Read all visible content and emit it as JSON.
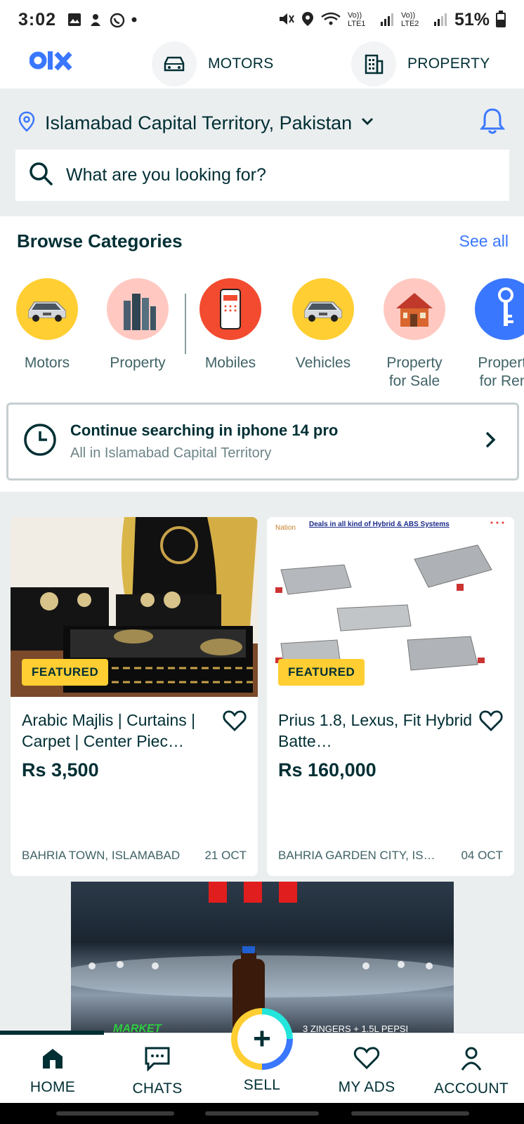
{
  "status": {
    "time": "3:02",
    "lte1": "Vo)) LTE1",
    "lte2": "Vo)) LTE2",
    "battery": "51%"
  },
  "top_nav": {
    "motors": "MOTORS",
    "property": "PROPERTY"
  },
  "location": {
    "text": "Islamabad Capital Territory, Pakistan"
  },
  "search": {
    "placeholder": "What are you looking for?"
  },
  "categories": {
    "title": "Browse Categories",
    "see_all": "See all",
    "items": [
      {
        "label": "Motors",
        "label2": ""
      },
      {
        "label": "Property",
        "label2": ""
      },
      {
        "label": "Mobiles",
        "label2": ""
      },
      {
        "label": "Vehicles",
        "label2": ""
      },
      {
        "label": "Property",
        "label2": "for Sale"
      },
      {
        "label": "Property",
        "label2": "for Rent"
      }
    ]
  },
  "continue_search": {
    "title": "Continue searching in iphone 14 pro",
    "subtitle": "All in Islamabad Capital Territory"
  },
  "ads": [
    {
      "badge": "FEATURED",
      "title": "Arabic Majlis | Curtains | Carpet | Center Piec…",
      "price": "Rs 3,500",
      "location": "BAHRIA TOWN, ISLAMABAD",
      "date": "21 OCT"
    },
    {
      "badge": "FEATURED",
      "title": "Prius 1.8, Lexus, Fit Hybrid Batte…",
      "price": "Rs 160,000",
      "location": "BAHRIA GARDEN CITY, IS…",
      "date": "04 OCT",
      "img_caption": "Deals in all kind of Hybrid & ABS Systems",
      "img_brand": "Nation"
    }
  ],
  "banner": {
    "text1": "MARKET",
    "text2": "3 ZINGERS + 1.5L PEPSI"
  },
  "bottom_nav": {
    "home": "HOME",
    "chats": "CHATS",
    "sell": "SELL",
    "my_ads": "MY ADS",
    "account": "ACCOUNT",
    "sell_symbol": "+"
  },
  "colors": {
    "brand": "#002f34",
    "accent_blue": "#3a77ff",
    "featured": "#ffce32",
    "teal": "#23e5db"
  }
}
